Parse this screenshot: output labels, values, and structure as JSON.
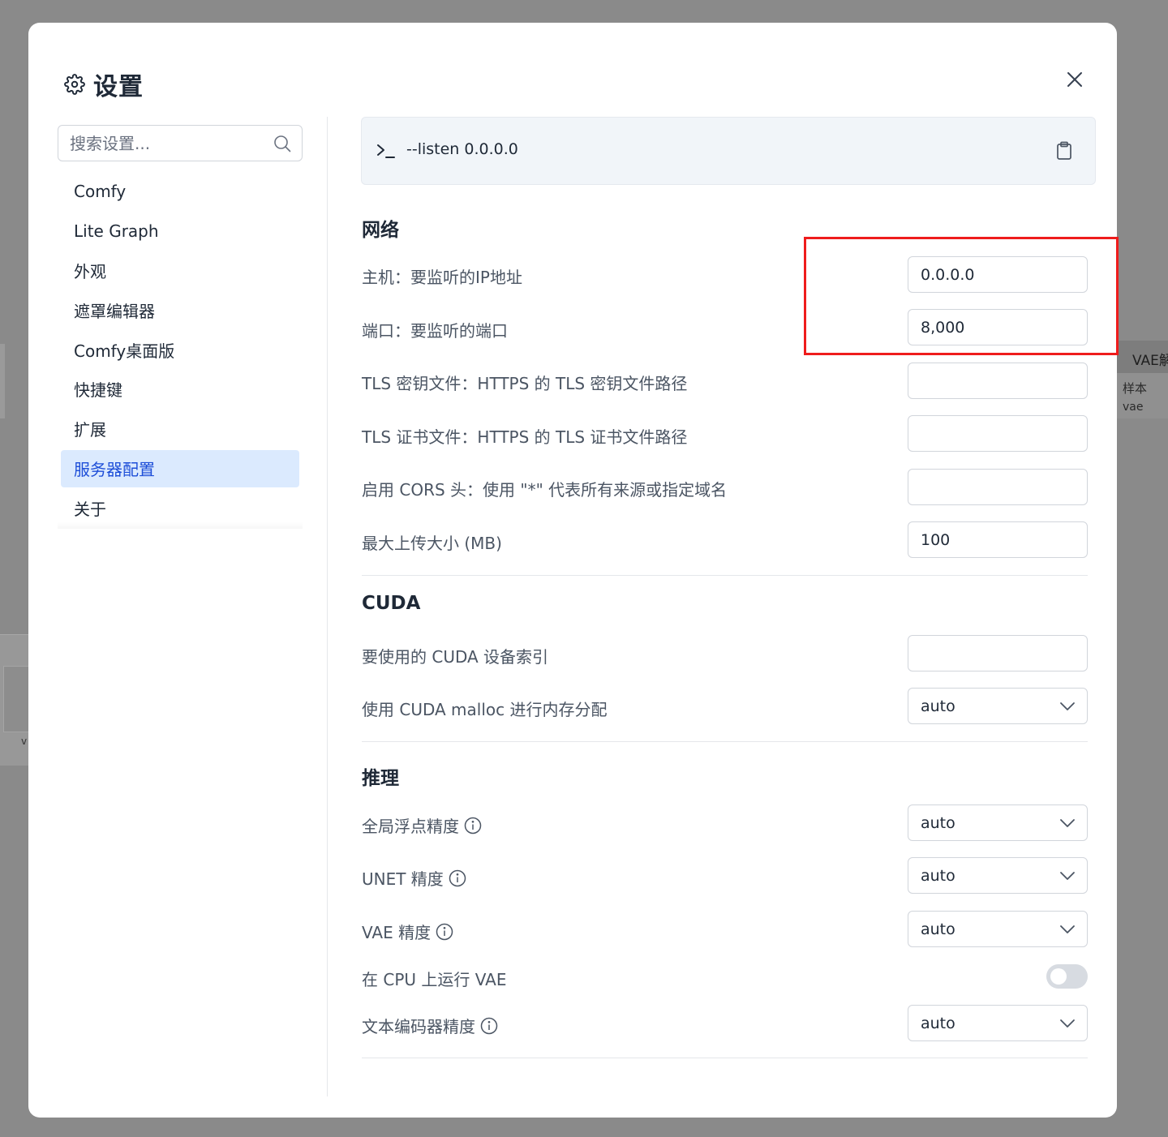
{
  "background": {
    "node_title": "VAE解码",
    "node_input_label": "样本",
    "node_input_value": "vae",
    "left_node_text": "v"
  },
  "dialog": {
    "title": "设置",
    "icons": {
      "settings": "gear-icon",
      "close": "close-icon"
    }
  },
  "sidebar": {
    "search_placeholder": "搜索设置...",
    "items": [
      {
        "label": "Comfy"
      },
      {
        "label": "Lite Graph"
      },
      {
        "label": "外观"
      },
      {
        "label": "遮罩编辑器"
      },
      {
        "label": "Comfy桌面版"
      },
      {
        "label": "快捷键"
      },
      {
        "label": "扩展"
      },
      {
        "label": "服务器配置",
        "active": true
      },
      {
        "label": "关于"
      }
    ]
  },
  "command": {
    "text": "--listen 0.0.0.0"
  },
  "sections": {
    "network": {
      "title": "网络",
      "host_label": "主机：要监听的IP地址",
      "host_value": "0.0.0.0",
      "port_label": "端口：要监听的端口",
      "port_value": "8,000",
      "tls_key_label": "TLS 密钥文件：HTTPS 的 TLS 密钥文件路径",
      "tls_key_value": "",
      "tls_cert_label": "TLS 证书文件：HTTPS 的 TLS 证书文件路径",
      "tls_cert_value": "",
      "cors_label": "启用 CORS 头：使用 \"*\" 代表所有来源或指定域名",
      "cors_value": "",
      "upload_label": "最大上传大小 (MB)",
      "upload_value": "100"
    },
    "cuda": {
      "title": "CUDA",
      "device_label": "要使用的 CUDA 设备索引",
      "device_value": "",
      "malloc_label": "使用 CUDA malloc 进行内存分配",
      "malloc_value": "auto"
    },
    "inference": {
      "title": "推理",
      "global_precision_label": "全局浮点精度",
      "global_precision_value": "auto",
      "unet_precision_label": "UNET 精度",
      "unet_precision_value": "auto",
      "vae_precision_label": "VAE 精度",
      "vae_precision_value": "auto",
      "vae_cpu_label": "在 CPU 上运行 VAE",
      "vae_cpu_enabled": false,
      "text_encoder_precision_label": "文本编码器精度",
      "text_encoder_precision_value": "auto"
    }
  },
  "colors": {
    "accent": "#1d4ed8",
    "active_bg": "#dbeafe",
    "highlight": "#ef1c1c"
  }
}
